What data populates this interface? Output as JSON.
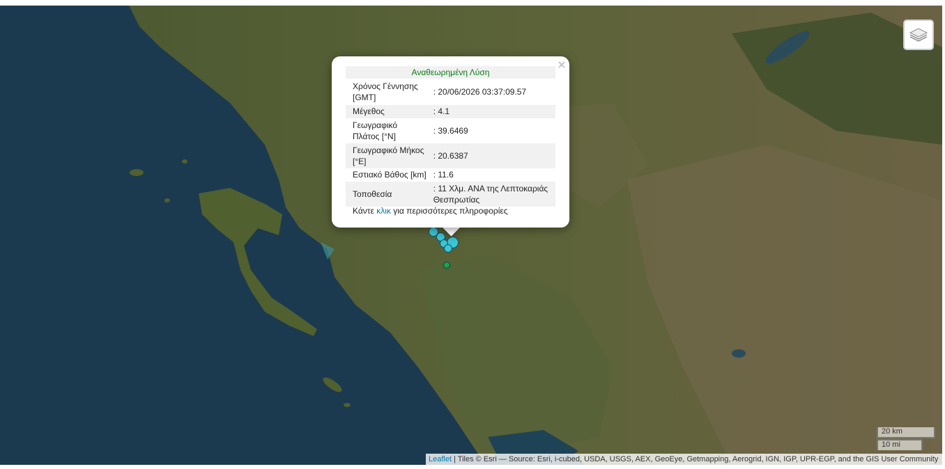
{
  "popup": {
    "title": "Αναθεωρημένη Λύση",
    "close_label": "×",
    "rows": [
      {
        "key": "Χρόνος Γέννησης [GMT]",
        "value": ": 20/06/2026 03:37:09.57"
      },
      {
        "key": "Μέγεθος",
        "value": ": 4.1"
      },
      {
        "key": "Γεωγραφικό Πλάτος [°N]",
        "value": ": 39.6469"
      },
      {
        "key": "Γεωγραφικό Μήκος [°E]",
        "value": ": 20.6387"
      },
      {
        "key": "Εστιακό Βάθος [km]",
        "value": ": 11.6"
      },
      {
        "key": "Τοποθεσία",
        "value": ": 11 Χλμ. ΑΝΑ της Λεπτοκαριάς Θεσπρωτίας"
      }
    ],
    "more_prefix": "Κάντε ",
    "more_link": "κλικ",
    "more_suffix": " για περισσότερες πληροφορίες"
  },
  "layers_control": {
    "icon": "layers-icon"
  },
  "scale": {
    "km": "20 km",
    "mi": "10 mi"
  },
  "attribution": {
    "leaflet": "Leaflet",
    "text": " | Tiles © Esri — Source: Esri, i-cubed, USDA, USGS, AEX, GeoEye, Getmapping, Aerogrid, IGN, IGP, UPR-EGP, and the GIS User Community"
  },
  "colors": {
    "marker_fill": "#3ec6d9",
    "marker_green": "#1aa05a",
    "title_green": "#0a7a16",
    "link": "#0078a8"
  }
}
